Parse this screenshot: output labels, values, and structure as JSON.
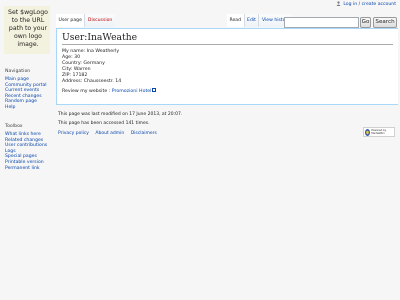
{
  "logo": {
    "text": "Set $wgLogo to the URL path to your own logo image."
  },
  "personal": {
    "login_label": "Log in / create account"
  },
  "tabs": {
    "user_page": "User page",
    "discussion": "Discussion",
    "read": "Read",
    "edit": "Edit",
    "view_history": "View history"
  },
  "search": {
    "value": "",
    "go_label": "Go",
    "search_label": "Search"
  },
  "page": {
    "title": "User:InaWeathe",
    "info_lines": [
      "My name: Ina Weatherly",
      "Age: 30",
      "Country: Germany",
      "City: Warren",
      "ZIP: 17182",
      "Address: Chausseestr. 14"
    ],
    "review_prefix": "Review my website :",
    "review_link": "Promozioni Hotel"
  },
  "sidebar": {
    "navigation": {
      "heading": "Navigation",
      "items": [
        "Main page",
        "Community portal",
        "Current events",
        "Recent changes",
        "Random page",
        "Help"
      ]
    },
    "toolbox": {
      "heading": "Toolbox",
      "items": [
        "What links here",
        "Related changes",
        "User contributions",
        "Logs",
        "Special pages",
        "Printable version",
        "Permanent link"
      ]
    }
  },
  "footer": {
    "modified": "This page was last modified on 17 June 2013, at 20:07.",
    "accessed": "This page has been accessed 141 times.",
    "links": [
      "Privacy policy",
      "About admin",
      "Disclaimers"
    ],
    "badge_text": "Powered by MediaWiki"
  }
}
